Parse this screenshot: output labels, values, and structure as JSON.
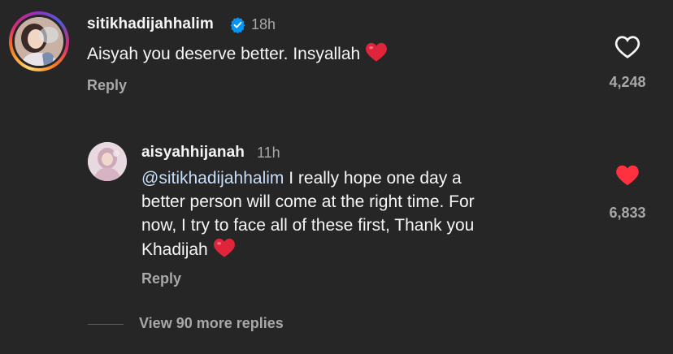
{
  "comment": {
    "username": "sitikhadijahhalim",
    "time": "18h",
    "text": "Aisyah you deserve better. Insyallah",
    "reply_label": "Reply",
    "likes": "4,248",
    "liked": false
  },
  "reply": {
    "username": "aisyahhijanah",
    "time": "11h",
    "mention": "@sitikhadijahhalim",
    "text_line1": " I really hope one day a",
    "text_line2": "better person will come at the right time. For",
    "text_line3": "now, I try to face all of these first, Thank you",
    "text_line4": "Khadijah",
    "reply_label": "Reply",
    "likes": "6,833",
    "liked": true
  },
  "view_more_label": "View 90 more replies",
  "colors": {
    "background": "#262626",
    "heart_red": "#ff3040",
    "verified_blue": "#0095f6",
    "secondary_text": "#a8a8a8"
  },
  "icons": {
    "verified": "verified-badge-icon",
    "like": "heart-icon",
    "emoji": "red-heart-emoji-icon"
  }
}
